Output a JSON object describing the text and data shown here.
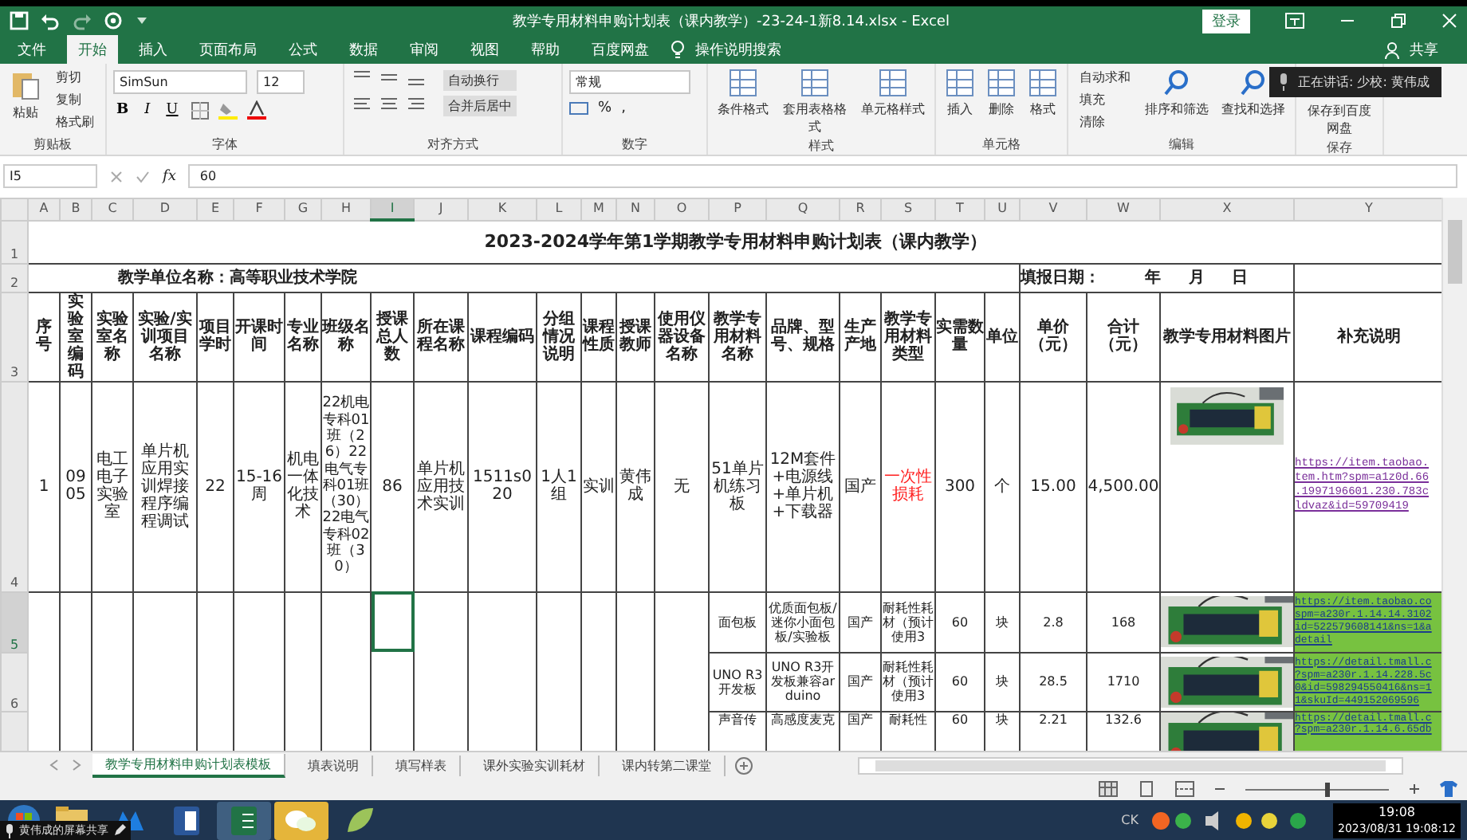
{
  "window": {
    "title": "教学专用材料申购计划表（课内教学）-23-24-1新8.14.xlsx  -  Excel",
    "login": "登录"
  },
  "menu": [
    {
      "label": "文件",
      "selected": false
    },
    {
      "label": "开始",
      "selected": true
    },
    {
      "label": "插入",
      "selected": false
    },
    {
      "label": "页面布局",
      "selected": false
    },
    {
      "label": "公式",
      "selected": false
    },
    {
      "label": "数据",
      "selected": false
    },
    {
      "label": "审阅",
      "selected": false
    },
    {
      "label": "视图",
      "selected": false
    },
    {
      "label": "帮助",
      "selected": false
    },
    {
      "label": "百度网盘",
      "selected": false
    }
  ],
  "tell_me": "操作说明搜索",
  "share": "共享",
  "ribbon": [
    {
      "label": "剪贴板",
      "kind": "clipboard",
      "big": "粘贴",
      "small": [
        "剪切",
        "复制",
        "格式刷"
      ]
    },
    {
      "label": "字体",
      "kind": "font",
      "font": "SimSun",
      "size": "12",
      "styles": [
        "B",
        "I",
        "U"
      ]
    },
    {
      "label": "对齐方式",
      "kind": "align",
      "buttons": [
        "自动换行",
        "合并后居中"
      ]
    },
    {
      "label": "数字",
      "kind": "number",
      "format": "常规",
      "symbols": [
        "%",
        ","
      ]
    },
    {
      "label": "样式",
      "kind": "large",
      "buttons": [
        "条件格式",
        "套用表格格式",
        "单元格样式"
      ]
    },
    {
      "label": "单元格",
      "kind": "large",
      "buttons": [
        "插入",
        "删除",
        "格式"
      ]
    },
    {
      "label": "编辑",
      "kind": "edit",
      "small": [
        "自动求和",
        "填充",
        "清除"
      ],
      "buttons": [
        "排序和筛选",
        "查找和选择"
      ]
    },
    {
      "label": "保存",
      "kind": "save",
      "buttons": [
        "保存到百度网盘"
      ]
    }
  ],
  "speaking": "正在讲话: 少校: 黄伟成",
  "formula_bar": {
    "name_box": "I5",
    "fx": "fx",
    "value": "60"
  },
  "columns": [
    {
      "label": "A",
      "selected": false
    },
    {
      "label": "B",
      "selected": false
    },
    {
      "label": "C",
      "selected": false
    },
    {
      "label": "D",
      "selected": false
    },
    {
      "label": "E",
      "selected": false
    },
    {
      "label": "F",
      "selected": false
    },
    {
      "label": "G",
      "selected": false
    },
    {
      "label": "H",
      "selected": false
    },
    {
      "label": "I",
      "selected": true
    },
    {
      "label": "J",
      "selected": false
    },
    {
      "label": "K",
      "selected": false
    },
    {
      "label": "L",
      "selected": false
    },
    {
      "label": "M",
      "selected": false
    },
    {
      "label": "N",
      "selected": false
    },
    {
      "label": "O",
      "selected": false
    },
    {
      "label": "P",
      "selected": false
    },
    {
      "label": "Q",
      "selected": false
    },
    {
      "label": "R",
      "selected": false
    },
    {
      "label": "S",
      "selected": false
    },
    {
      "label": "T",
      "selected": false
    },
    {
      "label": "U",
      "selected": false
    },
    {
      "label": "V",
      "selected": false
    },
    {
      "label": "W",
      "selected": false
    },
    {
      "label": "X",
      "selected": false
    },
    {
      "label": "Y",
      "selected": false
    }
  ],
  "row_headers": [
    {
      "label": "1",
      "selected": false
    },
    {
      "label": "2",
      "selected": false
    },
    {
      "label": "3",
      "selected": false
    },
    {
      "label": "4",
      "selected": false
    },
    {
      "label": "5",
      "selected": true
    },
    {
      "label": "6",
      "selected": false
    }
  ],
  "sheet_title": "2023-2024学年第1学期教学专用材料申购计划表（课内教学）",
  "unit": "教学单位名称：高等职业技术学院",
  "report_date": "填报日期：        年     月     日",
  "headers": [
    "序号",
    "实验室编码",
    "实验室名称",
    "实验/实训项目名称",
    "项目学时",
    "开课时间",
    "专业名称",
    "班级名称",
    "授课总人数",
    "所在课程名称",
    "课程编码",
    "分组情况说明",
    "课程性质",
    "授课教师",
    "使用仪器设备名称",
    "教学专用材料名称",
    "品牌、型号、规格",
    "生产产地",
    "教学专用材料类型",
    "实需数量",
    "单位",
    "单价（元）",
    "合计（元）",
    "教学专用材料图片",
    "补充说明"
  ],
  "rows": [
    {
      "cells": [
        {
          "text": "1"
        },
        {
          "text": "0905"
        },
        {
          "text": "电工电子实验室"
        },
        {
          "text": "单片机应用实训焊接程序编程调试"
        },
        {
          "text": "22"
        },
        {
          "text": "15-16周"
        },
        {
          "text": "机电一体化技术"
        },
        {
          "text": "22机电专科01班（26）22电气专科01班（30）22电气专科02班（30）"
        },
        {
          "text": "86"
        },
        {
          "text": "单片机应用技术实训"
        },
        {
          "text": "1511s020"
        },
        {
          "text": "1人1组"
        },
        {
          "text": "实训"
        },
        {
          "text": "黄伟成"
        },
        {
          "text": "无"
        },
        {
          "text": "51单片机练习板"
        },
        {
          "text": "12M套件+电源线+单片机+下载器"
        },
        {
          "text": "国产"
        },
        {
          "text": "一次性损耗",
          "color": "#ff2020"
        },
        {
          "text": "300"
        },
        {
          "text": "个"
        },
        {
          "text": "15.00"
        },
        {
          "text": "4,500.00"
        },
        {
          "kind": "picture"
        },
        {
          "kind": "link",
          "highlighted": false,
          "lines": [
            "https://item.taobao.",
            "tem.htm?spm=a1z0d.66",
            ".1997196601.230.783c",
            "ldvaz&id=59709419"
          ]
        }
      ]
    },
    {
      "cells": [
        {
          "text": "面包板"
        },
        {
          "text": "优质面包板/迷你小面包板/实验板"
        },
        {
          "text": "国产"
        },
        {
          "text": "耐耗性耗材（预计使用3"
        },
        {
          "text": "60"
        },
        {
          "text": "块"
        },
        {
          "text": "2.8"
        },
        {
          "text": "168"
        },
        {
          "kind": "picture"
        },
        {
          "kind": "link",
          "highlighted": true,
          "lines": [
            "https://item.taobao.co",
            "spm=a230r.1.14.14.3102",
            "id=522579608141&ns=1&a",
            "detail"
          ]
        }
      ]
    },
    {
      "cells": [
        {
          "text": "UNO R3开发板"
        },
        {
          "text": "UNO R3开发板兼容arduino"
        },
        {
          "text": "国产"
        },
        {
          "text": "耐耗性耗材（预计使用3"
        },
        {
          "text": "60"
        },
        {
          "text": "块"
        },
        {
          "text": "28.5"
        },
        {
          "text": "1710"
        },
        {
          "kind": "picture"
        },
        {
          "kind": "link",
          "highlighted": true,
          "lines": [
            "https://detail.tmall.c",
            "?spm=a230r.1.14.228.5c",
            "0&id=598294550416&ns=1",
            "1&skuId=449152069596"
          ]
        }
      ]
    },
    {
      "cells": [
        {
          "text": "声音传"
        },
        {
          "text": "高感度麦克"
        },
        {
          "text": "国产"
        },
        {
          "text": "耐耗性"
        },
        {
          "text": "60"
        },
        {
          "text": "块"
        },
        {
          "text": "2.21"
        },
        {
          "text": "132.6"
        },
        {
          "kind": "picture"
        },
        {
          "kind": "link",
          "highlighted": true,
          "lines": [
            "https://detail.tmall.c",
            "?spm=a230r.1.14.6.65db"
          ]
        }
      ]
    }
  ],
  "sheet_tabs": [
    {
      "label": "教学专用材料申购计划表模板",
      "selected": true
    },
    {
      "label": "填表说明",
      "selected": false
    },
    {
      "label": "填写样表",
      "selected": false
    },
    {
      "label": "课外实验实训耗材",
      "selected": false
    },
    {
      "label": "课内转第二课堂",
      "selected": false
    }
  ],
  "zoom": {
    "level": 0.55
  },
  "screen_share": "黄伟成的屏幕共享",
  "tray": {
    "ime": "CK",
    "time": "19:08",
    "datetime": "2023/08/31 19:08:12"
  }
}
